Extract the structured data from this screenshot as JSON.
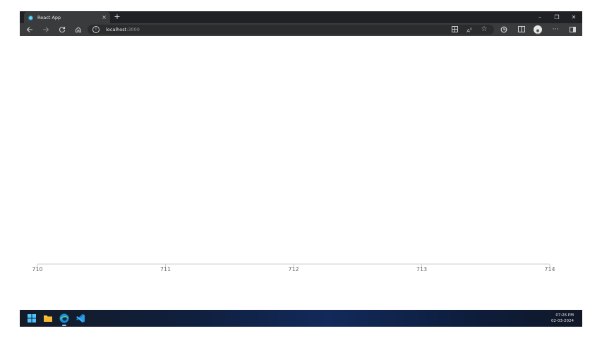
{
  "browser": {
    "tab_title": "React App",
    "tab_close": "×",
    "new_tab": "+",
    "window_controls": [
      "–",
      "❐",
      "✕"
    ],
    "nav_icons": [
      "back-icon",
      "forward-icon",
      "refresh-icon",
      "home-icon"
    ],
    "address_host": "localhost",
    "address_port": ":3000",
    "toolbar_icons": [
      "app-available-icon",
      "read-aloud-icon",
      "favorites-star-icon",
      "extensions-icon",
      "split-screen-icon",
      "profile-icon",
      "more-icon",
      "sidebar-icon"
    ],
    "more_label": "···"
  },
  "chart_data": {
    "type": "line",
    "x_ticks": [
      "710",
      "711",
      "712",
      "713",
      "714"
    ],
    "xlim": [
      710,
      714
    ],
    "series": [],
    "grid": false
  },
  "taskbar": {
    "icons": [
      "windows-start-icon",
      "file-explorer-icon",
      "edge-browser-icon",
      "vscode-icon"
    ],
    "time": "07:26 PM",
    "date": "02-03-2024"
  }
}
